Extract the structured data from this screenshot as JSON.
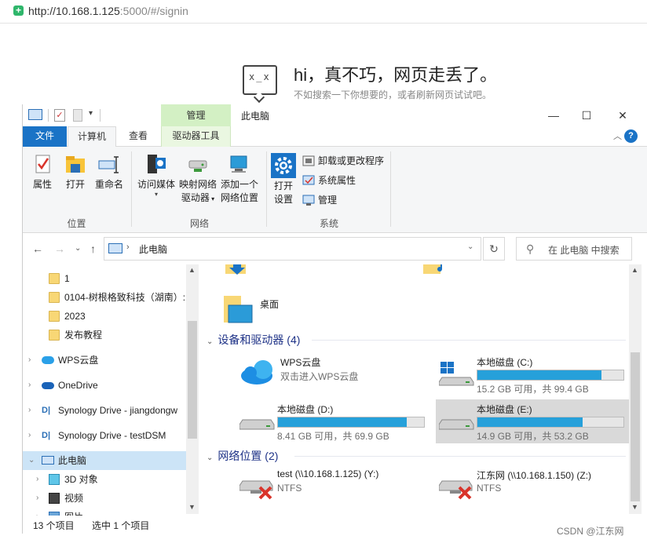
{
  "browser": {
    "url_main": "http://10.168.1.125",
    "url_rest": ":5000/#/signin"
  },
  "error_page": {
    "face": "x_x",
    "title": "hi，真不巧，网页走丢了。",
    "subtitle": "不如搜索一下你想要的，或者刷新网页试试吧。"
  },
  "titlebar": {
    "context_tab": "管理",
    "title": "此电脑",
    "minimize": "—",
    "maximize": "☐",
    "close": "✕"
  },
  "tabs": {
    "file": "文件",
    "computer": "计算机",
    "view": "查看",
    "drive_tools": "驱动器工具",
    "collapse": "︿",
    "help": "?"
  },
  "ribbon": {
    "properties": "属性",
    "open": "打开",
    "rename": "重命名",
    "group_location": "位置",
    "access_media": "访问媒体",
    "map_drive_l1": "映射网络",
    "map_drive_l2": "驱动器",
    "add_location_l1": "添加一个",
    "add_location_l2": "网络位置",
    "group_network": "网络",
    "open_settings_l1": "打开",
    "open_settings_l2": "设置",
    "uninstall": "卸载或更改程序",
    "system_properties": "系统属性",
    "manage": "管理",
    "group_system": "系统"
  },
  "navbar": {
    "path": "此电脑",
    "search_placeholder": "在 此电脑 中搜索"
  },
  "tree": [
    {
      "label": "1",
      "icon": "folder"
    },
    {
      "label": "0104-树根格致科技（湖南）:",
      "icon": "folder"
    },
    {
      "label": "2023",
      "icon": "folder"
    },
    {
      "label": "发布教程",
      "icon": "folder"
    },
    {
      "label": "WPS云盘",
      "icon": "wps-cloud"
    },
    {
      "label": "OneDrive",
      "icon": "onedrive"
    },
    {
      "label": "Synology Drive - jiangdongw",
      "icon": "synology"
    },
    {
      "label": "Synology Drive - testDSM",
      "icon": "synology"
    },
    {
      "label": "此电脑",
      "icon": "computer"
    },
    {
      "label": "3D 对象",
      "icon": "3d-objects"
    },
    {
      "label": "视频",
      "icon": "video"
    },
    {
      "label": "图片",
      "icon": "pictures"
    }
  ],
  "content": {
    "desktop_label": "桌面",
    "devices_header": "设备和驱动器 (4)",
    "network_header": "网络位置 (2)",
    "wps": {
      "name": "WPS云盘",
      "desc": "双击进入WPS云盘"
    },
    "drives": [
      {
        "name": "本地磁盘 (C:)",
        "free": "15.2 GB 可用，共 99.4 GB",
        "used_fraction": 0.847
      },
      {
        "name": "本地磁盘 (D:)",
        "free": "8.41 GB 可用，共 69.9 GB",
        "used_fraction": 0.88
      },
      {
        "name": "本地磁盘 (E:)",
        "free": "14.9 GB 可用，共 53.2 GB",
        "used_fraction": 0.72
      }
    ],
    "network": [
      {
        "name": "test (\\\\10.168.1.125) (Y:)",
        "fs": "NTFS"
      },
      {
        "name": "江东网 (\\\\10.168.1.150) (Z:)",
        "fs": "NTFS"
      }
    ]
  },
  "status": {
    "count": "13 个项目",
    "selected": "选中 1 个项目"
  },
  "watermark": "CSDN @江东网",
  "colors": {
    "accent": "#1a73c6",
    "bar": "#26a0da",
    "drive_tools_tab": "#d3f0c4",
    "selection": "#cce4f7"
  }
}
